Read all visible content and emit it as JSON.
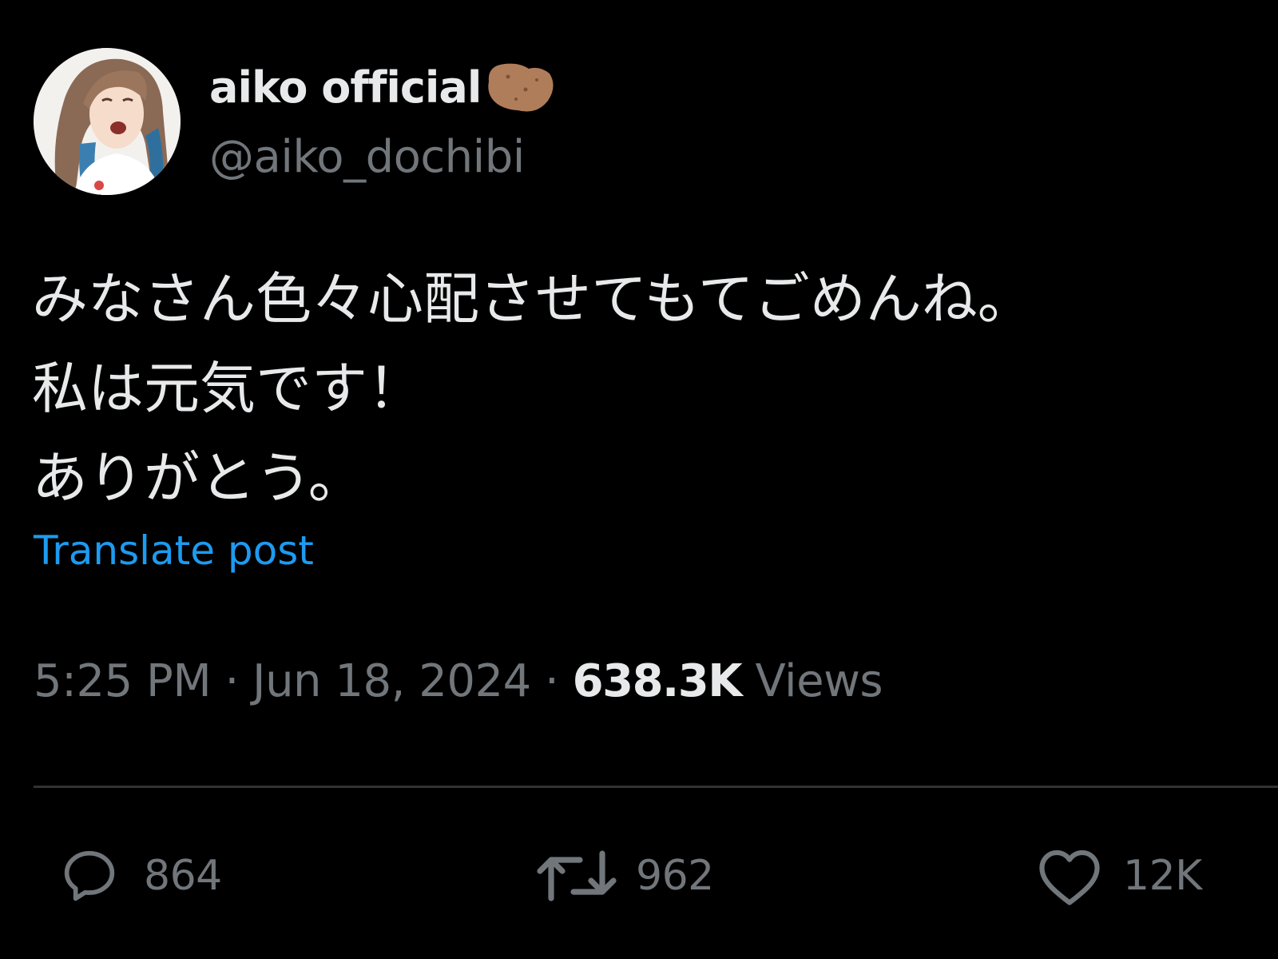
{
  "author": {
    "display_name": "aiko official",
    "name_emoji_icon": "potato-icon",
    "handle": "@aiko_dochibi"
  },
  "post": {
    "lines": [
      "みなさん色々心配させてもてごめんね。",
      "私は元気です！",
      "ありがとう。"
    ],
    "translate_label": "Translate post"
  },
  "meta": {
    "time": "5:25 PM",
    "separator": " · ",
    "date": "Jun 18, 2024",
    "views_count": "638.3K",
    "views_label": " Views"
  },
  "actions": {
    "reply": {
      "icon": "reply-icon",
      "count": "864"
    },
    "repost": {
      "icon": "repost-icon",
      "count": "962"
    },
    "like": {
      "icon": "heart-icon",
      "count": "12K"
    }
  },
  "colors": {
    "background": "#000000",
    "text_primary": "#e7e9ea",
    "text_secondary": "#71767b",
    "link": "#1d9bf0",
    "divider": "#2f3336"
  }
}
